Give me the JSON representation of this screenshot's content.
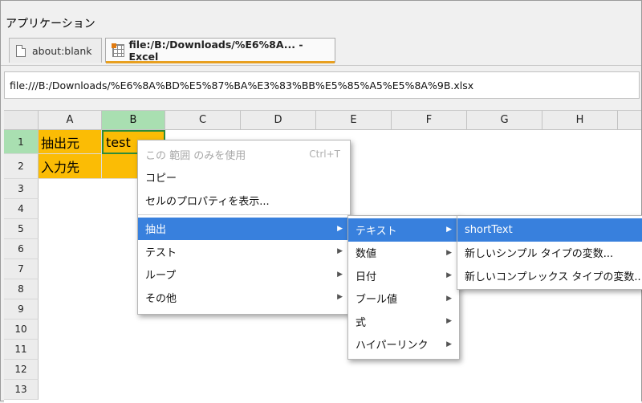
{
  "app_title": "アプリケーション",
  "tabs": [
    {
      "label": "about:blank",
      "icon": "page-icon"
    },
    {
      "label": "file:/B:/Downloads/%E6%8A... - Excel",
      "icon": "excel-icon"
    }
  ],
  "address": "file:///B:/Downloads/%E6%8A%BD%E5%87%BA%E3%83%BB%E5%85%A5%E5%8A%9B.xlsx",
  "sheet": {
    "columns": [
      "A",
      "B",
      "C",
      "D",
      "E",
      "F",
      "G",
      "H"
    ],
    "rows": [
      "1",
      "2",
      "3",
      "4",
      "5",
      "6",
      "7",
      "8",
      "9",
      "10",
      "11",
      "12",
      "13"
    ],
    "cells": {
      "A1": "抽出元",
      "B1": "test",
      "A2": "入力先"
    },
    "selected_cell": "B1",
    "highlight_color": "#fbbc05",
    "selection_color": "#a9dfb1"
  },
  "context_menu": {
    "items": [
      {
        "label": "この 範囲 のみを使用",
        "shortcut": "Ctrl+T",
        "disabled": true
      },
      {
        "label": "コピー"
      },
      {
        "label": "セルのプロパティを表示..."
      },
      {
        "label": "抽出",
        "submenu": true,
        "highlighted": true
      },
      {
        "label": "テスト",
        "submenu": true
      },
      {
        "label": "ループ",
        "submenu": true
      },
      {
        "label": "その他",
        "submenu": true
      }
    ]
  },
  "submenu1": {
    "items": [
      {
        "label": "テキスト",
        "submenu": true,
        "highlighted": true
      },
      {
        "label": "数値",
        "submenu": true
      },
      {
        "label": "日付",
        "submenu": true
      },
      {
        "label": "ブール値",
        "submenu": true
      },
      {
        "label": "式",
        "submenu": true
      },
      {
        "label": "ハイパーリンク",
        "submenu": true
      }
    ]
  },
  "submenu2": {
    "items": [
      {
        "label": "shortText",
        "highlighted": true
      },
      {
        "label": "新しいシンプル タイプの変数..."
      },
      {
        "label": "新しいコンプレックス タイプの変数..."
      }
    ]
  },
  "accent_color": "#3880dd"
}
